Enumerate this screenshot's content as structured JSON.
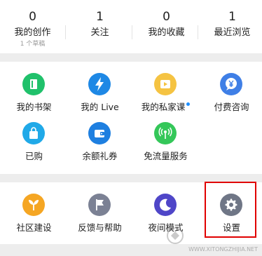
{
  "stats": [
    {
      "value": "0",
      "label": "我的创作",
      "sub": "1 个草稿"
    },
    {
      "value": "1",
      "label": "关注",
      "sub": ""
    },
    {
      "value": "0",
      "label": "我的收藏",
      "sub": ""
    },
    {
      "value": "1",
      "label": "最近浏览",
      "sub": ""
    }
  ],
  "menu1": [
    {
      "label": "我的书架",
      "icon": "bookshelf-icon",
      "color": "#20c16b"
    },
    {
      "label": "我的 Live",
      "icon": "lightning-icon",
      "color": "#1e88e5"
    },
    {
      "label": "我的私家课",
      "icon": "video-icon",
      "color": "#f5c342"
    },
    {
      "label": "付费咨询",
      "icon": "yuan-chat-icon",
      "color": "#3f7fe6"
    },
    {
      "label": "已购",
      "icon": "shopping-bag-icon",
      "color": "#20a9e8"
    },
    {
      "label": "余额礼券",
      "icon": "wallet-icon",
      "color": "#1e7fe0"
    },
    {
      "label": "免流量服务",
      "icon": "signal-icon",
      "color": "#34c759"
    }
  ],
  "menu2": [
    {
      "label": "社区建设",
      "icon": "sprout-icon",
      "color": "#f5a623"
    },
    {
      "label": "反馈与帮助",
      "icon": "flag-icon",
      "color": "#7b8194"
    },
    {
      "label": "夜间模式",
      "icon": "moon-icon",
      "color": "#4f46c8"
    },
    {
      "label": "设置",
      "icon": "gear-icon",
      "color": "#6f7686"
    }
  ],
  "watermark": {
    "text": "WWW.XITONGZHIJIA.NET"
  }
}
